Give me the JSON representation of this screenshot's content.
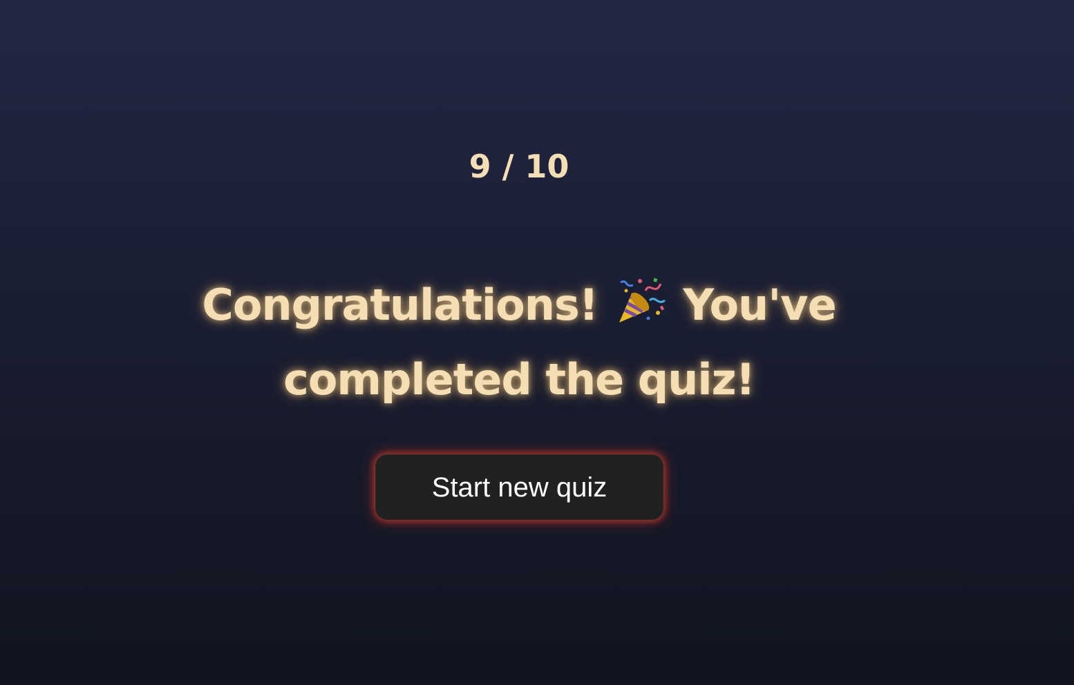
{
  "result": {
    "score_text": "9 / 10",
    "message_before_emoji": "Congratulations!",
    "emoji_icon": "party-popper-icon",
    "message_after_emoji": "You've completed the quiz!"
  },
  "actions": {
    "start_new_label": "Start new quiz"
  },
  "colors": {
    "text_accent": "#f5deb3",
    "button_bg": "#212121",
    "button_glow": "#dc3c28",
    "background_top": "#222844",
    "background_bottom": "#11141f"
  }
}
